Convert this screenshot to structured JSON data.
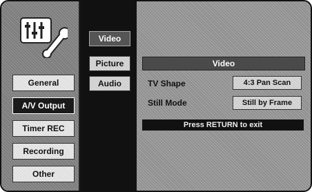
{
  "logo": {
    "icon": "settings-tools-icon"
  },
  "main_menu": [
    {
      "label": "General",
      "selected": false
    },
    {
      "label": "A/V Output",
      "selected": true
    },
    {
      "label": "Timer REC",
      "selected": false
    },
    {
      "label": "Recording",
      "selected": false
    },
    {
      "label": "Other",
      "selected": false
    }
  ],
  "sub_menu": [
    {
      "label": "Video",
      "selected": true
    },
    {
      "label": "Picture",
      "selected": false
    },
    {
      "label": "Audio",
      "selected": false
    }
  ],
  "content": {
    "title": "Video",
    "rows": [
      {
        "label": "TV Shape",
        "value": "4:3 Pan Scan"
      },
      {
        "label": "Still Mode",
        "value": "Still by Frame"
      }
    ],
    "exit_hint": "Press RETURN to exit"
  }
}
